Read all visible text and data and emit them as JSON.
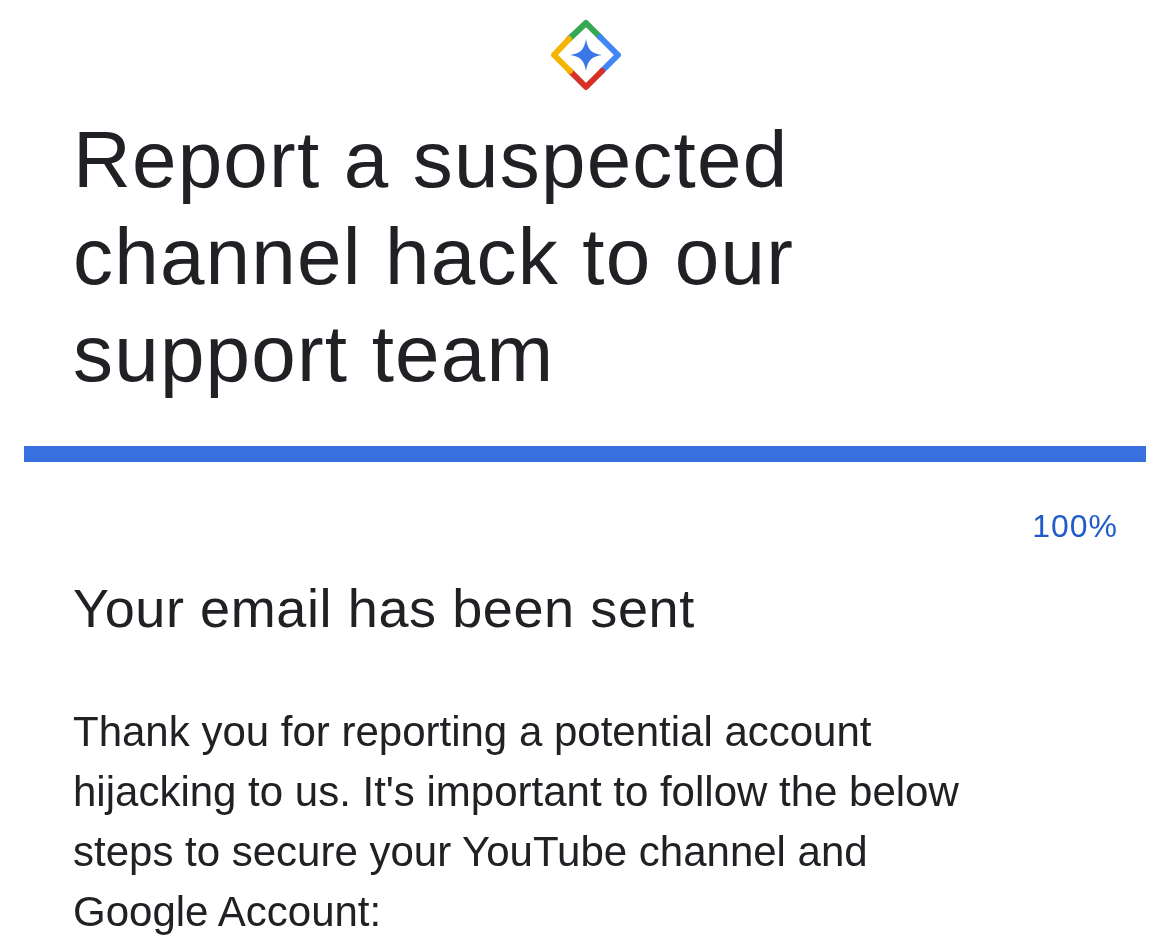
{
  "title": "Report a suspected channel hack to our support team",
  "progress": {
    "level": 1,
    "reading": "100%"
  },
  "confirmation": {
    "heading": "Your email has been sent",
    "body": "Thank you for reporting a potential account hijacking to us. It's important to follow the below steps to secure your YouTube channel and Google Account:"
  }
}
